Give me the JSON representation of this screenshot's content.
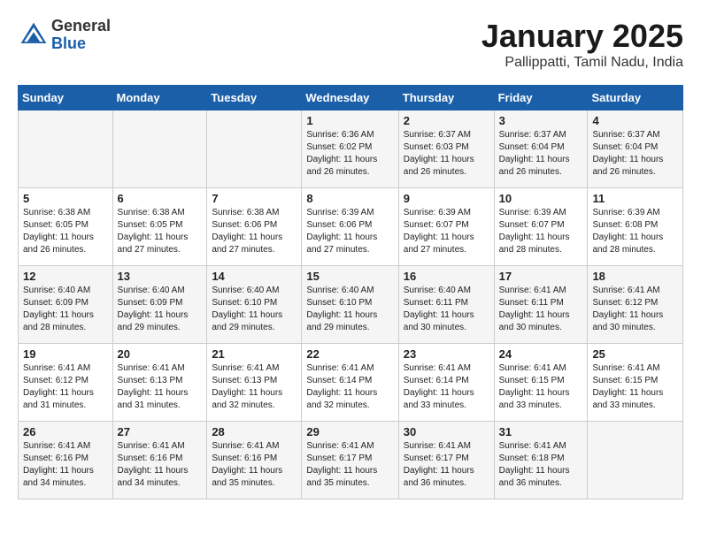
{
  "logo": {
    "general": "General",
    "blue": "Blue"
  },
  "header": {
    "title": "January 2025",
    "subtitle": "Pallippatti, Tamil Nadu, India"
  },
  "weekdays": [
    "Sunday",
    "Monday",
    "Tuesday",
    "Wednesday",
    "Thursday",
    "Friday",
    "Saturday"
  ],
  "weeks": [
    [
      {
        "day": "",
        "sunrise": "",
        "sunset": "",
        "daylight": ""
      },
      {
        "day": "",
        "sunrise": "",
        "sunset": "",
        "daylight": ""
      },
      {
        "day": "",
        "sunrise": "",
        "sunset": "",
        "daylight": ""
      },
      {
        "day": "1",
        "sunrise": "Sunrise: 6:36 AM",
        "sunset": "Sunset: 6:02 PM",
        "daylight": "Daylight: 11 hours and 26 minutes."
      },
      {
        "day": "2",
        "sunrise": "Sunrise: 6:37 AM",
        "sunset": "Sunset: 6:03 PM",
        "daylight": "Daylight: 11 hours and 26 minutes."
      },
      {
        "day": "3",
        "sunrise": "Sunrise: 6:37 AM",
        "sunset": "Sunset: 6:04 PM",
        "daylight": "Daylight: 11 hours and 26 minutes."
      },
      {
        "day": "4",
        "sunrise": "Sunrise: 6:37 AM",
        "sunset": "Sunset: 6:04 PM",
        "daylight": "Daylight: 11 hours and 26 minutes."
      }
    ],
    [
      {
        "day": "5",
        "sunrise": "Sunrise: 6:38 AM",
        "sunset": "Sunset: 6:05 PM",
        "daylight": "Daylight: 11 hours and 26 minutes."
      },
      {
        "day": "6",
        "sunrise": "Sunrise: 6:38 AM",
        "sunset": "Sunset: 6:05 PM",
        "daylight": "Daylight: 11 hours and 27 minutes."
      },
      {
        "day": "7",
        "sunrise": "Sunrise: 6:38 AM",
        "sunset": "Sunset: 6:06 PM",
        "daylight": "Daylight: 11 hours and 27 minutes."
      },
      {
        "day": "8",
        "sunrise": "Sunrise: 6:39 AM",
        "sunset": "Sunset: 6:06 PM",
        "daylight": "Daylight: 11 hours and 27 minutes."
      },
      {
        "day": "9",
        "sunrise": "Sunrise: 6:39 AM",
        "sunset": "Sunset: 6:07 PM",
        "daylight": "Daylight: 11 hours and 27 minutes."
      },
      {
        "day": "10",
        "sunrise": "Sunrise: 6:39 AM",
        "sunset": "Sunset: 6:07 PM",
        "daylight": "Daylight: 11 hours and 28 minutes."
      },
      {
        "day": "11",
        "sunrise": "Sunrise: 6:39 AM",
        "sunset": "Sunset: 6:08 PM",
        "daylight": "Daylight: 11 hours and 28 minutes."
      }
    ],
    [
      {
        "day": "12",
        "sunrise": "Sunrise: 6:40 AM",
        "sunset": "Sunset: 6:09 PM",
        "daylight": "Daylight: 11 hours and 28 minutes."
      },
      {
        "day": "13",
        "sunrise": "Sunrise: 6:40 AM",
        "sunset": "Sunset: 6:09 PM",
        "daylight": "Daylight: 11 hours and 29 minutes."
      },
      {
        "day": "14",
        "sunrise": "Sunrise: 6:40 AM",
        "sunset": "Sunset: 6:10 PM",
        "daylight": "Daylight: 11 hours and 29 minutes."
      },
      {
        "day": "15",
        "sunrise": "Sunrise: 6:40 AM",
        "sunset": "Sunset: 6:10 PM",
        "daylight": "Daylight: 11 hours and 29 minutes."
      },
      {
        "day": "16",
        "sunrise": "Sunrise: 6:40 AM",
        "sunset": "Sunset: 6:11 PM",
        "daylight": "Daylight: 11 hours and 30 minutes."
      },
      {
        "day": "17",
        "sunrise": "Sunrise: 6:41 AM",
        "sunset": "Sunset: 6:11 PM",
        "daylight": "Daylight: 11 hours and 30 minutes."
      },
      {
        "day": "18",
        "sunrise": "Sunrise: 6:41 AM",
        "sunset": "Sunset: 6:12 PM",
        "daylight": "Daylight: 11 hours and 30 minutes."
      }
    ],
    [
      {
        "day": "19",
        "sunrise": "Sunrise: 6:41 AM",
        "sunset": "Sunset: 6:12 PM",
        "daylight": "Daylight: 11 hours and 31 minutes."
      },
      {
        "day": "20",
        "sunrise": "Sunrise: 6:41 AM",
        "sunset": "Sunset: 6:13 PM",
        "daylight": "Daylight: 11 hours and 31 minutes."
      },
      {
        "day": "21",
        "sunrise": "Sunrise: 6:41 AM",
        "sunset": "Sunset: 6:13 PM",
        "daylight": "Daylight: 11 hours and 32 minutes."
      },
      {
        "day": "22",
        "sunrise": "Sunrise: 6:41 AM",
        "sunset": "Sunset: 6:14 PM",
        "daylight": "Daylight: 11 hours and 32 minutes."
      },
      {
        "day": "23",
        "sunrise": "Sunrise: 6:41 AM",
        "sunset": "Sunset: 6:14 PM",
        "daylight": "Daylight: 11 hours and 33 minutes."
      },
      {
        "day": "24",
        "sunrise": "Sunrise: 6:41 AM",
        "sunset": "Sunset: 6:15 PM",
        "daylight": "Daylight: 11 hours and 33 minutes."
      },
      {
        "day": "25",
        "sunrise": "Sunrise: 6:41 AM",
        "sunset": "Sunset: 6:15 PM",
        "daylight": "Daylight: 11 hours and 33 minutes."
      }
    ],
    [
      {
        "day": "26",
        "sunrise": "Sunrise: 6:41 AM",
        "sunset": "Sunset: 6:16 PM",
        "daylight": "Daylight: 11 hours and 34 minutes."
      },
      {
        "day": "27",
        "sunrise": "Sunrise: 6:41 AM",
        "sunset": "Sunset: 6:16 PM",
        "daylight": "Daylight: 11 hours and 34 minutes."
      },
      {
        "day": "28",
        "sunrise": "Sunrise: 6:41 AM",
        "sunset": "Sunset: 6:16 PM",
        "daylight": "Daylight: 11 hours and 35 minutes."
      },
      {
        "day": "29",
        "sunrise": "Sunrise: 6:41 AM",
        "sunset": "Sunset: 6:17 PM",
        "daylight": "Daylight: 11 hours and 35 minutes."
      },
      {
        "day": "30",
        "sunrise": "Sunrise: 6:41 AM",
        "sunset": "Sunset: 6:17 PM",
        "daylight": "Daylight: 11 hours and 36 minutes."
      },
      {
        "day": "31",
        "sunrise": "Sunrise: 6:41 AM",
        "sunset": "Sunset: 6:18 PM",
        "daylight": "Daylight: 11 hours and 36 minutes."
      },
      {
        "day": "",
        "sunrise": "",
        "sunset": "",
        "daylight": ""
      }
    ]
  ]
}
